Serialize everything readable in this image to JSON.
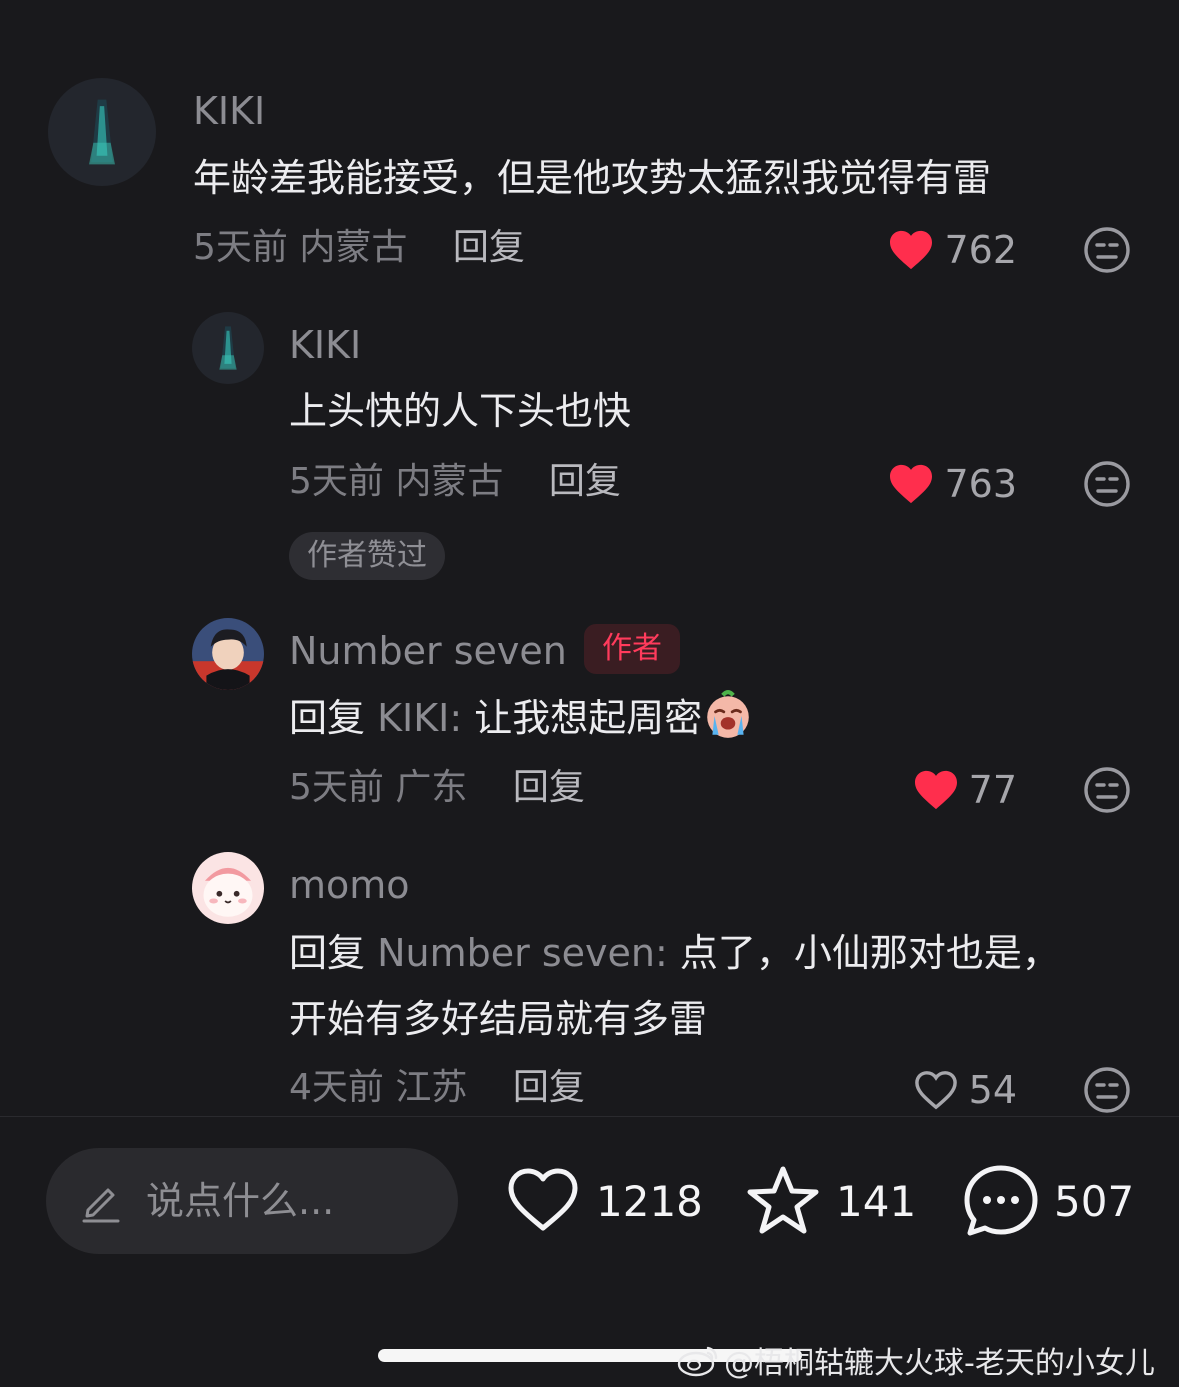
{
  "comments": [
    {
      "username": "KIKI",
      "text": "年龄差我能接受，但是他攻势太猛烈我觉得有雷",
      "time": "5天前",
      "location": "内蒙古",
      "reply_label": "回复",
      "likes": "762",
      "liked": true
    },
    {
      "username": "KIKI",
      "text": "上头快的人下头也快",
      "time": "5天前",
      "location": "内蒙古",
      "reply_label": "回复",
      "likes": "763",
      "liked": true,
      "badge": "作者赞过"
    },
    {
      "username": "Number seven",
      "author_tag": "作者",
      "reply_prefix": "回复",
      "reply_to": "KIKI:",
      "text": "让我想起周密",
      "emoji": "crying-face-emoji",
      "time": "5天前",
      "location": "广东",
      "reply_label": "回复",
      "likes": "77",
      "liked": true
    },
    {
      "username": "momo",
      "reply_prefix": "回复",
      "reply_to": "Number seven:",
      "text_line1": "点了，小仙那对也是，",
      "text_line2": "开始有多好结局就有多雷",
      "time": "4天前",
      "location": "江苏",
      "reply_label": "回复",
      "likes": "54",
      "liked": false
    }
  ],
  "bottom_bar": {
    "input_placeholder": "说点什么...",
    "like_count": "1218",
    "favorite_count": "141",
    "comment_count": "507"
  },
  "watermark": "@梧桐轱辘大火球-老天的小女儿",
  "colors": {
    "background": "#19191c",
    "like_red": "#ff2e4d",
    "author_tag": "#ff3b5c"
  }
}
